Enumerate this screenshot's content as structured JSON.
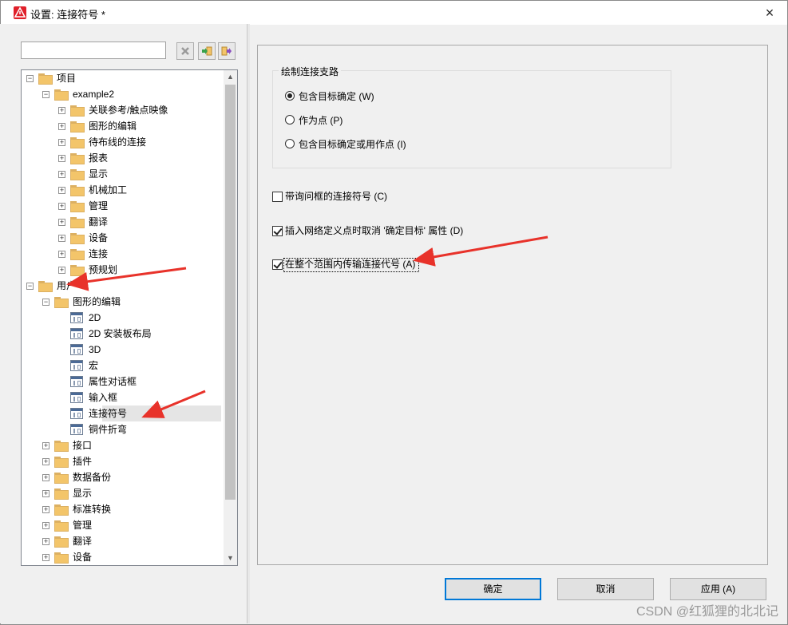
{
  "window": {
    "title": "设置: 连接符号 *",
    "close_label": "×"
  },
  "left": {
    "search": {
      "value": "",
      "placeholder": ""
    },
    "toolbar": [
      {
        "name": "clear-filter-icon",
        "glyph": "✖"
      },
      {
        "name": "expand-all-icon",
        "glyph": "⇥"
      },
      {
        "name": "collapse-all-icon",
        "glyph": "⇤"
      }
    ],
    "tree": [
      {
        "label": "项目",
        "level": 0,
        "expanded": true,
        "icon": "folder"
      },
      {
        "label": "example2",
        "level": 1,
        "expanded": true,
        "icon": "folder"
      },
      {
        "label": "关联参考/触点映像",
        "level": 2,
        "expanded": false,
        "icon": "folder"
      },
      {
        "label": "图形的编辑",
        "level": 2,
        "expanded": false,
        "icon": "folder"
      },
      {
        "label": "待布线的连接",
        "level": 2,
        "expanded": false,
        "icon": "folder"
      },
      {
        "label": "报表",
        "level": 2,
        "expanded": false,
        "icon": "folder"
      },
      {
        "label": "显示",
        "level": 2,
        "expanded": false,
        "icon": "folder"
      },
      {
        "label": "机械加工",
        "level": 2,
        "expanded": false,
        "icon": "folder"
      },
      {
        "label": "管理",
        "level": 2,
        "expanded": false,
        "icon": "folder"
      },
      {
        "label": "翻译",
        "level": 2,
        "expanded": false,
        "icon": "folder"
      },
      {
        "label": "设备",
        "level": 2,
        "expanded": false,
        "icon": "folder"
      },
      {
        "label": "连接",
        "level": 2,
        "expanded": false,
        "icon": "folder"
      },
      {
        "label": "预规划",
        "level": 2,
        "expanded": false,
        "icon": "folder"
      },
      {
        "label": "用户",
        "level": 0,
        "expanded": true,
        "icon": "folder"
      },
      {
        "label": "图形的编辑",
        "level": 1,
        "expanded": true,
        "icon": "folder"
      },
      {
        "label": "2D",
        "level": 2,
        "icon": "doc"
      },
      {
        "label": "2D 安装板布局",
        "level": 2,
        "icon": "doc"
      },
      {
        "label": "3D",
        "level": 2,
        "icon": "doc"
      },
      {
        "label": "宏",
        "level": 2,
        "icon": "doc"
      },
      {
        "label": "属性对话框",
        "level": 2,
        "icon": "doc"
      },
      {
        "label": "输入框",
        "level": 2,
        "icon": "doc"
      },
      {
        "label": "连接符号",
        "level": 2,
        "icon": "doc",
        "selected": true
      },
      {
        "label": "铜件折弯",
        "level": 2,
        "icon": "doc"
      },
      {
        "label": "接口",
        "level": 1,
        "expanded": false,
        "icon": "folder"
      },
      {
        "label": "插件",
        "level": 1,
        "expanded": false,
        "icon": "folder"
      },
      {
        "label": "数据备份",
        "level": 1,
        "expanded": false,
        "icon": "folder"
      },
      {
        "label": "显示",
        "level": 1,
        "expanded": false,
        "icon": "folder"
      },
      {
        "label": "标准转换",
        "level": 1,
        "expanded": false,
        "icon": "folder"
      },
      {
        "label": "管理",
        "level": 1,
        "expanded": false,
        "icon": "folder"
      },
      {
        "label": "翻译",
        "level": 1,
        "expanded": false,
        "icon": "folder"
      },
      {
        "label": "设备",
        "level": 1,
        "expanded": false,
        "icon": "folder"
      }
    ]
  },
  "right": {
    "group_title": "绘制连接支路",
    "radios": [
      {
        "label": "包含目标确定 (W)",
        "checked": true
      },
      {
        "label": "作为点 (P)",
        "checked": false
      },
      {
        "label": "包含目标确定或用作点 (I)",
        "checked": false
      }
    ],
    "checkboxes": [
      {
        "label": "带询问框的连接符号 (C)",
        "checked": false
      },
      {
        "label": "插入网络定义点时取消 '确定目标' 属性 (D)",
        "checked": true
      },
      {
        "label": "在整个范围内传输连接代号 (A)",
        "checked": true,
        "focused": true
      }
    ]
  },
  "buttons": {
    "ok": "确定",
    "cancel": "取消",
    "apply": "应用 (A)"
  },
  "watermark": "CSDN @红狐狸的北北记",
  "colors": {
    "annotation_arrow": "#e8322a",
    "folder": "#f3c56a",
    "accent": "#0078d7"
  }
}
